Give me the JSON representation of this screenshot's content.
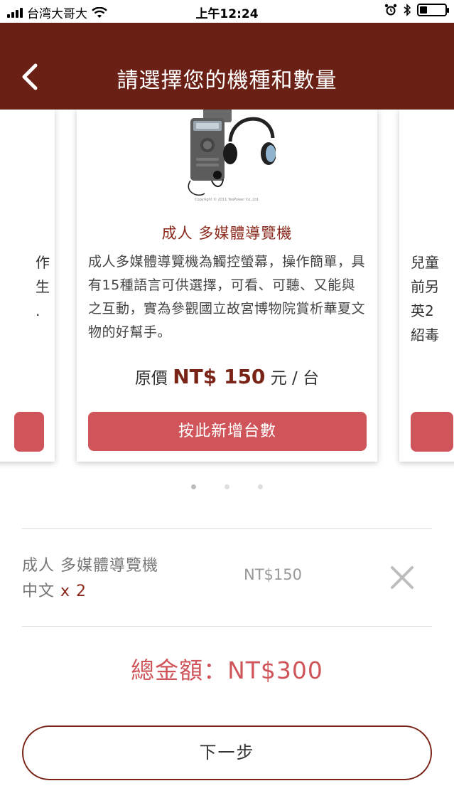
{
  "status_bar": {
    "carrier": "台湾大哥大",
    "time": "上午12:24",
    "battery_level": 0.3
  },
  "header": {
    "title": "請選擇您的機種和數量",
    "back_icon": "chevron-left-icon"
  },
  "carousel": {
    "left_card_text": [
      "作",
      "生",
      "."
    ],
    "right_card_text": [
      "兒童",
      "前另",
      "英2",
      "紹毒"
    ],
    "main_card": {
      "copyright": "Copyright © 2011 YesPower Co.,Ltd.",
      "title": "成人 多媒體導覽機",
      "description": "成人多媒體導覽機為觸控螢幕，操作簡單，具有15種語言可供選擇，可看、可聽、又能與之互動，實為參觀國立故宮博物院賞析華夏文物的好幫手。",
      "price_prefix": "原價",
      "price_amount": "NT$ 150",
      "price_suffix": "元 / 台",
      "add_button": "按此新增台數"
    },
    "page_count": 3,
    "active_page": 0
  },
  "order": {
    "item_name": "成人 多媒體導覽機",
    "language": "中文",
    "quantity": "x 2",
    "price": "NT$150",
    "remove_icon": "close-icon"
  },
  "total": "總金額：NT$300",
  "next_button": "下一步",
  "colors": {
    "header_bg": "#6b2015",
    "accent": "#cf555a",
    "title_red": "#8b2a1c"
  }
}
